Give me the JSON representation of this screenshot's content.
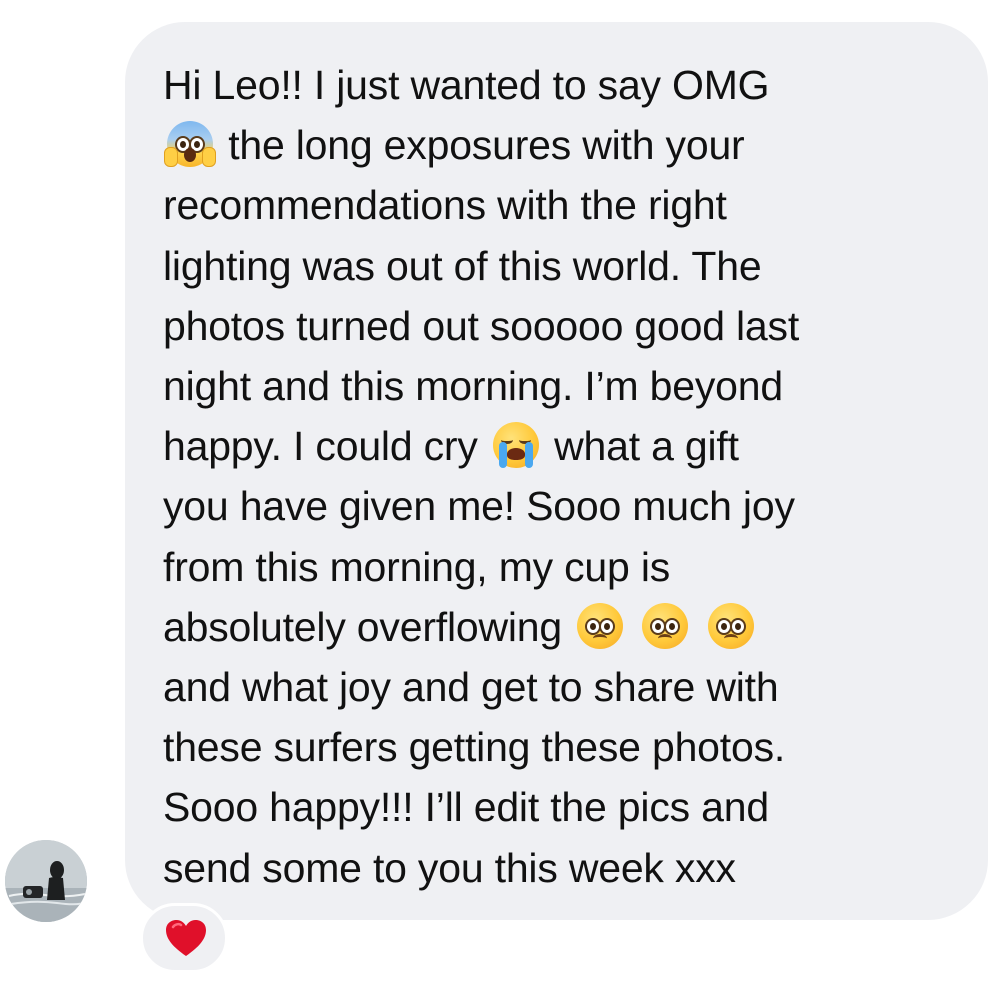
{
  "message": {
    "lines": [
      [
        {
          "t": "Hi Leo!! I just wanted to say OMG"
        }
      ],
      [
        {
          "e": "scream-emoji"
        },
        {
          "t": " the long exposures with your"
        }
      ],
      [
        {
          "t": "recommendations with the right"
        }
      ],
      [
        {
          "t": "lighting was out of this world. The"
        }
      ],
      [
        {
          "t": "photos turned out sooooo good last"
        }
      ],
      [
        {
          "t": "night and this morning. I’m beyond"
        }
      ],
      [
        {
          "t": "happy. I could cry "
        },
        {
          "e": "crying-emoji"
        },
        {
          "t": " what a gift"
        }
      ],
      [
        {
          "t": "you have given me! Sooo much joy"
        }
      ],
      [
        {
          "t": "from this morning, my cup is"
        }
      ],
      [
        {
          "t": "absolutely overflowing "
        },
        {
          "e": "pleading-emoji"
        },
        {
          "t": " "
        },
        {
          "e": "pleading-emoji"
        },
        {
          "t": " "
        },
        {
          "e": "pleading-emoji"
        }
      ],
      [
        {
          "t": "and what joy and get to share with"
        }
      ],
      [
        {
          "t": "these surfers getting these photos."
        }
      ],
      [
        {
          "t": "Sooo happy!!! I’ll edit the pics and"
        }
      ],
      [
        {
          "t": "send some to you this week xxx"
        }
      ]
    ],
    "reaction": "heart-emoji"
  },
  "colors": {
    "bubble": "#eff0f3",
    "text": "#111111",
    "heart": "#e0102a"
  }
}
